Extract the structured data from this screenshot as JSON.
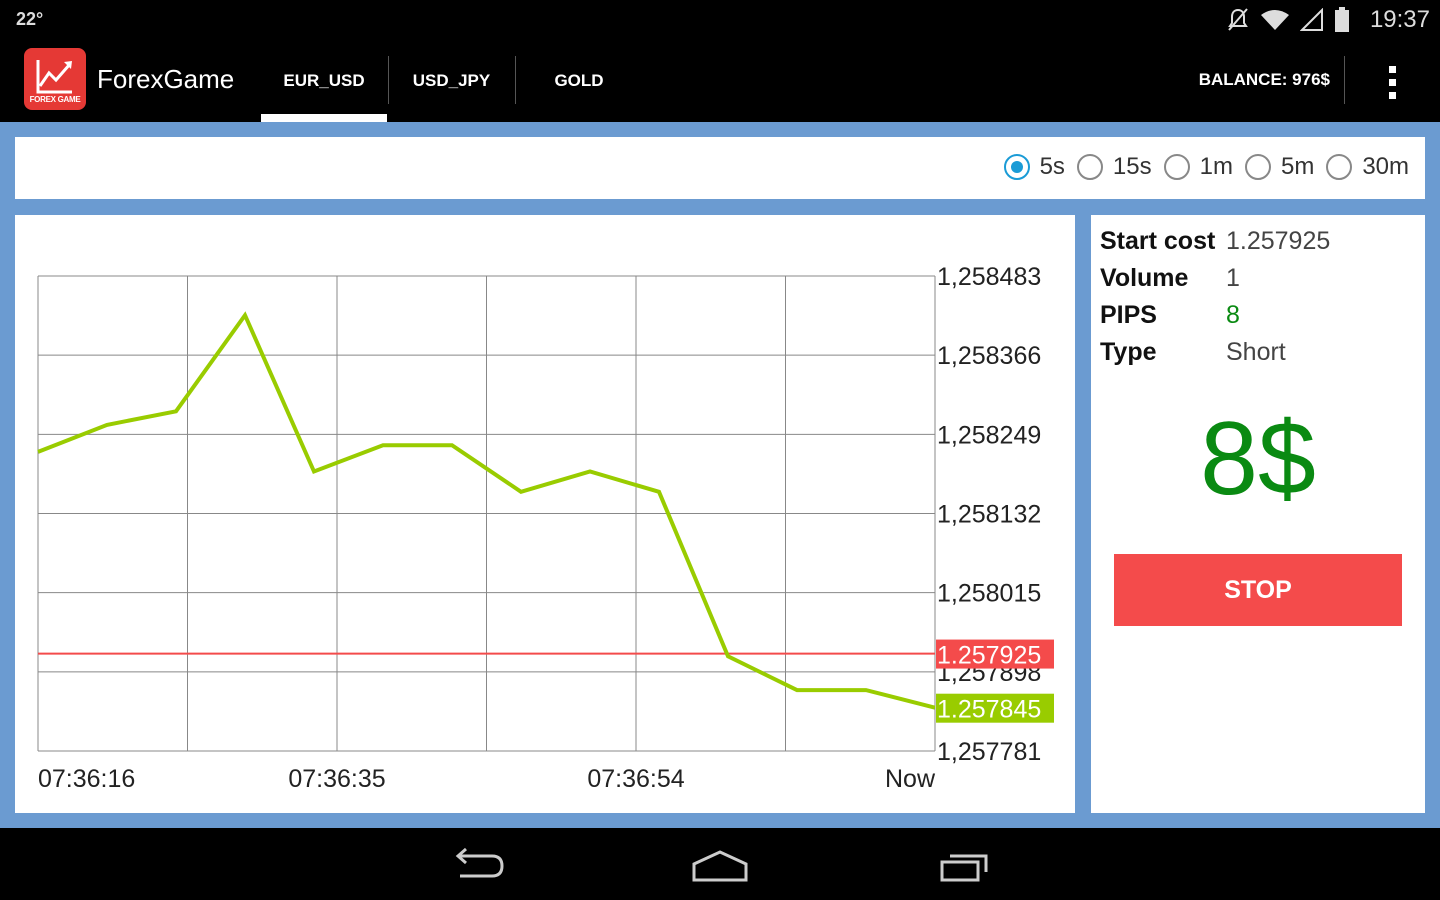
{
  "status_bar": {
    "temperature": "22°",
    "time": "19:37"
  },
  "action_bar": {
    "app_title": "ForexGame",
    "logo_text": "FOREX GAME",
    "tabs": [
      {
        "label": "EUR_USD",
        "active": true
      },
      {
        "label": "USD_JPY",
        "active": false
      },
      {
        "label": "GOLD",
        "active": false
      }
    ],
    "balance": "BALANCE: 976$"
  },
  "timeframes": {
    "options": [
      "5s",
      "15s",
      "1m",
      "5m",
      "30m"
    ],
    "selected": "5s"
  },
  "trade": {
    "rows": [
      {
        "key": "Start cost",
        "value": "1.257925"
      },
      {
        "key": "Volume",
        "value": "1"
      },
      {
        "key": "PIPS",
        "value": "8"
      },
      {
        "key": "Type",
        "value": "Short"
      }
    ],
    "pips_color": "#0a8a12",
    "profit": "8$",
    "stop_label": "STOP"
  },
  "colors": {
    "line": "#99cc00",
    "start_line": "#f44b4b",
    "profit": "#0a8a12",
    "background": "#6b9bd1"
  },
  "chart_data": {
    "type": "line",
    "y_ticks": [
      "1,258483",
      "1,258366",
      "1,258249",
      "1,258132",
      "1,258015",
      "1,257898",
      "1,257781"
    ],
    "ylim": [
      1.257781,
      1.258483
    ],
    "x_ticks": [
      "07:36:16",
      "07:36:35",
      "07:36:54",
      "Now"
    ],
    "series": [
      {
        "values": [
          1.258223,
          1.258263,
          1.258283,
          1.258425,
          1.258194,
          1.258233,
          1.258233,
          1.258164,
          1.258194,
          1.258164,
          1.257921,
          1.257871,
          1.257871,
          1.257845
        ]
      }
    ],
    "start_line": {
      "value": 1.257925,
      "label": "1.257925"
    },
    "current": {
      "value": 1.257845,
      "label": "1.257845"
    },
    "grid": true
  }
}
